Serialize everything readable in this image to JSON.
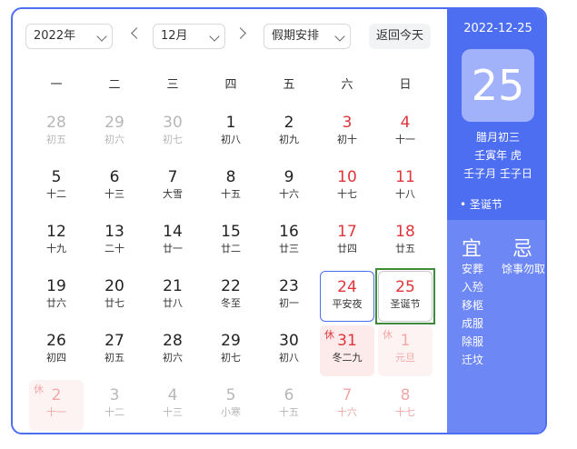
{
  "toolbar": {
    "year_value": "2022年",
    "month_value": "12月",
    "holiday_value": "假期安排",
    "today_button": "返回今天"
  },
  "weekdays": [
    "一",
    "二",
    "三",
    "四",
    "五",
    "六",
    "日"
  ],
  "weeks": [
    [
      {
        "n": "28",
        "s": "初五",
        "t": "dim"
      },
      {
        "n": "29",
        "s": "初六",
        "t": "dim"
      },
      {
        "n": "30",
        "s": "初七",
        "t": "dim"
      },
      {
        "n": "1",
        "s": "初八",
        "t": "norm"
      },
      {
        "n": "2",
        "s": "初九",
        "t": "norm"
      },
      {
        "n": "3",
        "s": "初十",
        "t": "red"
      },
      {
        "n": "4",
        "s": "十一",
        "t": "red"
      }
    ],
    [
      {
        "n": "5",
        "s": "十二",
        "t": "norm"
      },
      {
        "n": "6",
        "s": "十三",
        "t": "norm"
      },
      {
        "n": "7",
        "s": "大雪",
        "t": "norm"
      },
      {
        "n": "8",
        "s": "十五",
        "t": "norm"
      },
      {
        "n": "9",
        "s": "十六",
        "t": "norm"
      },
      {
        "n": "10",
        "s": "十七",
        "t": "red"
      },
      {
        "n": "11",
        "s": "十八",
        "t": "red"
      }
    ],
    [
      {
        "n": "12",
        "s": "十九",
        "t": "norm"
      },
      {
        "n": "13",
        "s": "二十",
        "t": "norm"
      },
      {
        "n": "14",
        "s": "廿一",
        "t": "norm"
      },
      {
        "n": "15",
        "s": "廿二",
        "t": "norm"
      },
      {
        "n": "16",
        "s": "廿三",
        "t": "norm"
      },
      {
        "n": "17",
        "s": "廿四",
        "t": "red"
      },
      {
        "n": "18",
        "s": "廿五",
        "t": "red"
      }
    ],
    [
      {
        "n": "19",
        "s": "廿六",
        "t": "norm"
      },
      {
        "n": "20",
        "s": "廿七",
        "t": "norm"
      },
      {
        "n": "21",
        "s": "廿八",
        "t": "norm"
      },
      {
        "n": "22",
        "s": "冬至",
        "t": "norm"
      },
      {
        "n": "23",
        "s": "初一",
        "t": "norm"
      },
      {
        "n": "24",
        "s": "平安夜",
        "t": "red",
        "eve": true
      },
      {
        "n": "25",
        "s": "圣诞节",
        "t": "red",
        "sel": true
      }
    ],
    [
      {
        "n": "26",
        "s": "初四",
        "t": "norm"
      },
      {
        "n": "27",
        "s": "初五",
        "t": "norm"
      },
      {
        "n": "28",
        "s": "初六",
        "t": "norm"
      },
      {
        "n": "29",
        "s": "初七",
        "t": "norm"
      },
      {
        "n": "30",
        "s": "初八",
        "t": "norm"
      },
      {
        "n": "31",
        "s": "冬二九",
        "t": "red",
        "hol": "休"
      },
      {
        "n": "1",
        "s": "元旦",
        "t": "dimred",
        "hol": "休",
        "holdim": true
      }
    ],
    [
      {
        "n": "2",
        "s": "十一",
        "t": "dimred",
        "hol": "休",
        "holdim": true
      },
      {
        "n": "3",
        "s": "十二",
        "t": "dim"
      },
      {
        "n": "4",
        "s": "十三",
        "t": "dim"
      },
      {
        "n": "5",
        "s": "小寒",
        "t": "dim"
      },
      {
        "n": "6",
        "s": "十五",
        "t": "dim"
      },
      {
        "n": "7",
        "s": "十六",
        "t": "dimred"
      },
      {
        "n": "8",
        "s": "十七",
        "t": "dimred"
      }
    ]
  ],
  "panel": {
    "date": "2022-12-25",
    "day": "25",
    "lunar": "腊月初三",
    "ganzhi_year": "壬寅年 虎",
    "ganzhi_month_day": "壬子月 壬子日",
    "festival": "• 圣诞节",
    "yi_title": "宜",
    "ji_title": "忌",
    "yi_items": [
      "安葬",
      "入殓",
      "移柩",
      "成服",
      "除服",
      "迁坟"
    ],
    "ji_item": "馀事勿取"
  },
  "colors": {
    "accent": "#4e6ef2",
    "red": "#e0353a",
    "selected_outline": "#3f8a3a"
  }
}
